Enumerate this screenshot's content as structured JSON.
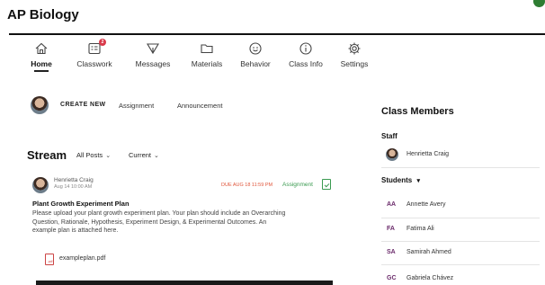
{
  "app": {
    "title": "AP Biology"
  },
  "nav": {
    "items": [
      {
        "label": "Home",
        "icon": "home-icon",
        "active": true
      },
      {
        "label": "Classwork",
        "icon": "classwork-icon",
        "badge": "2"
      },
      {
        "label": "Messages",
        "icon": "send-icon"
      },
      {
        "label": "Materials",
        "icon": "folder-icon"
      },
      {
        "label": "Behavior",
        "icon": "smiley-icon"
      },
      {
        "label": "Class Info",
        "icon": "info-icon"
      },
      {
        "label": "Settings",
        "icon": "gear-icon"
      }
    ]
  },
  "create": {
    "label": "CREATE NEW",
    "assignment": "Assignment",
    "announcement": "Announcement"
  },
  "stream": {
    "title": "Stream",
    "filter_all": "All Posts",
    "filter_current": "Current"
  },
  "post": {
    "author": "Henrietta Craig",
    "posted": "Aug 14 10:00 AM",
    "due": "DUE AUG 18 11:59 PM",
    "tag": "Assignment",
    "title": "Plant Growth Experiment Plan",
    "body": "Please upload your plant growth experiment plan. Your plan should include an Overarching Question, Rationale, Hypothesis, Experiment Design, & Experimental Outcomes. An example plan is attached here.",
    "attachment": "exampleplan.pdf"
  },
  "sidebar": {
    "title": "Class Members",
    "staff_label": "Staff",
    "staff": [
      {
        "name": "Henrietta Craig"
      }
    ],
    "students_label": "Students",
    "students": [
      {
        "initials": "AA",
        "name": "Annette Avery"
      },
      {
        "initials": "FA",
        "name": "Fatima Ali"
      },
      {
        "initials": "SA",
        "name": "Samirah Ahmed"
      },
      {
        "initials": "GC",
        "name": "Gabriela Chávez"
      }
    ]
  },
  "colors": {
    "accent_green": "#3a9a50",
    "due_red": "#e0553a",
    "badge_red": "#d93a4a",
    "initials_purple": "#6a2a6a"
  }
}
